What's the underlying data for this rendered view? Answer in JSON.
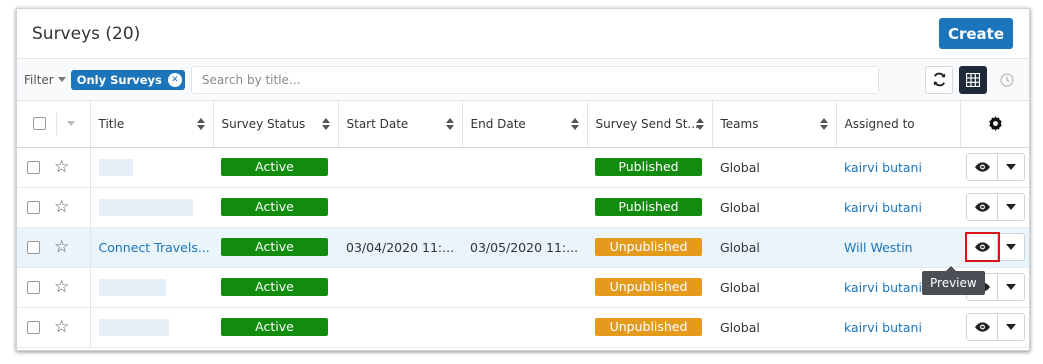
{
  "header": {
    "title": "Surveys (20)",
    "create_label": "Create"
  },
  "toolbar": {
    "filter_label": "Filter",
    "chip_label": "Only Surveys",
    "search_placeholder": "Search by title..."
  },
  "columns": [
    "Title",
    "Survey Status",
    "Start Date",
    "End Date",
    "Survey Send St...",
    "Teams",
    "Assigned to"
  ],
  "rows": [
    {
      "title": "",
      "status": "Active",
      "start": "",
      "end": "",
      "send_status": "Published",
      "team": "Global",
      "assigned": "kairvi butani"
    },
    {
      "title": "",
      "status": "Active",
      "start": "",
      "end": "",
      "send_status": "Published",
      "team": "Global",
      "assigned": "kairvi butani"
    },
    {
      "title": "Connect Travels...",
      "status": "Active",
      "start": "03/04/2020 11:...",
      "end": "03/05/2020 11:...",
      "send_status": "Unpublished",
      "team": "Global",
      "assigned": "Will Westin"
    },
    {
      "title": "",
      "status": "Active",
      "start": "",
      "end": "",
      "send_status": "Unpublished",
      "team": "Global",
      "assigned": "kairvi butani"
    },
    {
      "title": "",
      "status": "Active",
      "start": "",
      "end": "",
      "send_status": "Unpublished",
      "team": "Global",
      "assigned": "kairvi butani"
    }
  ],
  "tooltip": "Preview",
  "colors": {
    "accent": "#1b75bc",
    "active": "#128c0f",
    "unpublished": "#e49b1c",
    "highlight": "#d9141a"
  }
}
